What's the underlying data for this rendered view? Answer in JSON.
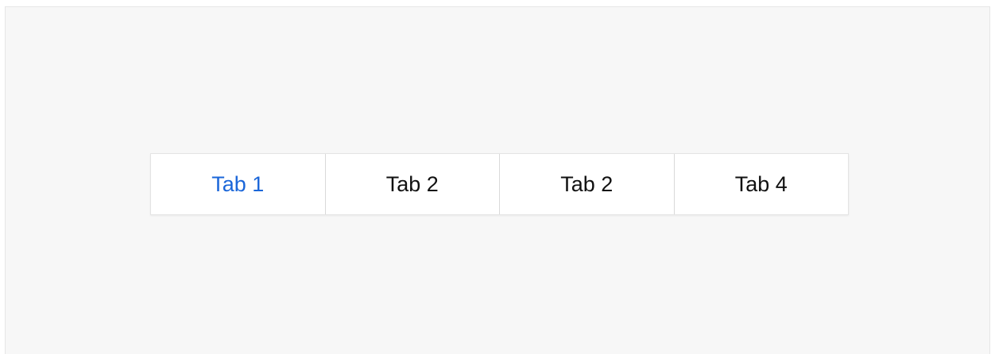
{
  "tabs": [
    {
      "label": "Tab 1",
      "active": true
    },
    {
      "label": "Tab 2",
      "active": false
    },
    {
      "label": "Tab 2",
      "active": false
    },
    {
      "label": "Tab 4",
      "active": false
    }
  ],
  "colors": {
    "active_tab_text": "#1a66d9",
    "tab_text": "#111111",
    "canvas_background": "#f7f7f7",
    "tab_background": "#ffffff"
  }
}
